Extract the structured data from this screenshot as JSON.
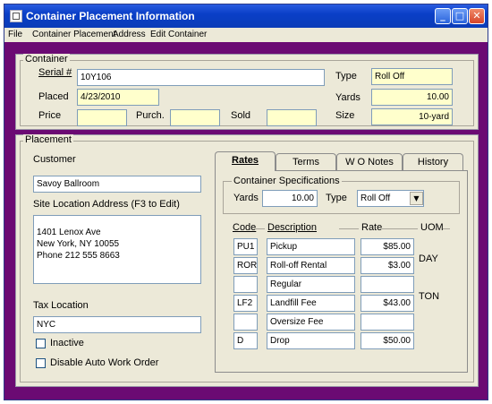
{
  "window": {
    "title": "Container Placement Information",
    "min_icon": "minimize-glyph",
    "max_icon": "maximize-glyph",
    "close_icon": "close-glyph"
  },
  "menu": [
    "File",
    "Container Placement",
    "Address",
    "Edit Container"
  ],
  "container": {
    "group_label": "Container",
    "serial_label": "Serial #",
    "serial_value": "10Y106",
    "placed_label": "Placed",
    "placed_value": "4/23/2010",
    "price_label": "Price",
    "price_value": "",
    "purch_label": "Purch.",
    "purch_value": "",
    "sold_label": "Sold",
    "sold_value": "",
    "type_label": "Type",
    "type_value": "Roll Off",
    "yards_label": "Yards",
    "yards_value": "10.00",
    "size_label": "Size",
    "size_value": "10-yard"
  },
  "placement": {
    "group_label": "Placement",
    "customer_label": "Customer",
    "customer_value": "Savoy Ballroom",
    "address_label": "Site Location Address (F3 to Edit)",
    "address_value": "1401 Lenox Ave\nNew York, NY 10055\nPhone 212 555 8663",
    "tax_label": "Tax  Location",
    "tax_value": "NYC",
    "inactive_label": "Inactive",
    "disable_label": "Disable Auto Work Order"
  },
  "tabs": [
    "Rates",
    "Terms",
    "W O Notes",
    "History"
  ],
  "rates": {
    "spec_label": "Container Specifications",
    "yards_label": "Yards",
    "yards_value": "10.00",
    "type_label": "Type",
    "type_value": "Roll Off",
    "col_code": "Code",
    "col_desc": "Description",
    "col_rate": "Rate",
    "col_uom": "UOM",
    "rows": [
      {
        "code": "PU1",
        "desc": "Pickup",
        "rate": "$85.00",
        "uom": ""
      },
      {
        "code": "ROR",
        "desc": "Roll-off Rental",
        "rate": "$3.00",
        "uom": "DAY"
      },
      {
        "code": "",
        "desc": "Regular",
        "rate": "",
        "uom": ""
      },
      {
        "code": "LF2",
        "desc": "Landfill Fee",
        "rate": "$43.00",
        "uom": "TON"
      },
      {
        "code": "",
        "desc": "Oversize Fee",
        "rate": "",
        "uom": ""
      },
      {
        "code": "D",
        "desc": "Drop",
        "rate": "$50.00",
        "uom": ""
      }
    ]
  },
  "colors": {
    "frame": "#6b0a73",
    "titlebar": "#0a3fc7",
    "panel": "#ece9d8",
    "yellow_field": "#ffffcc"
  }
}
